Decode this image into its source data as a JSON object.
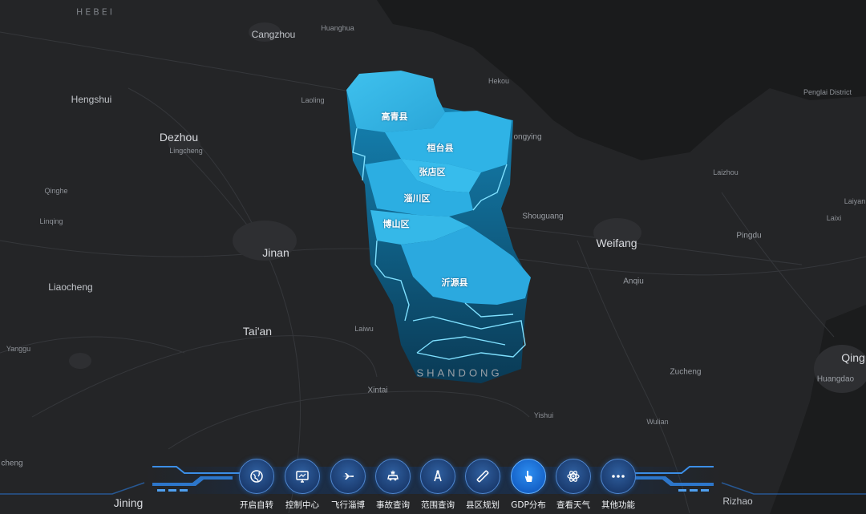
{
  "map": {
    "province_labels": [
      {
        "name": "hebei",
        "text": "HEBEI"
      }
    ],
    "city_labels": [
      {
        "id": "cangzhou",
        "text": "Cangzhou",
        "size": "md"
      },
      {
        "id": "huanghua",
        "text": "Huanghua",
        "size": "xs"
      },
      {
        "id": "hengshui",
        "text": "Hengshui",
        "size": "md"
      },
      {
        "id": "laoling",
        "text": "Laoling",
        "size": "xs"
      },
      {
        "id": "hekou",
        "text": "Hekou",
        "size": "xs"
      },
      {
        "id": "penglai",
        "text": "Penglai District",
        "size": "xs"
      },
      {
        "id": "dezhou",
        "text": "Dezhou",
        "size": "lg"
      },
      {
        "id": "lingcheng",
        "text": "Lingcheng",
        "size": "xs"
      },
      {
        "id": "dongying",
        "text": "ongying",
        "size": "sm"
      },
      {
        "id": "laizhou",
        "text": "Laizhou",
        "size": "xs"
      },
      {
        "id": "qinghe",
        "text": "Qinghe",
        "size": "xs"
      },
      {
        "id": "laiyang",
        "text": "Laiyan",
        "size": "xs"
      },
      {
        "id": "linqing",
        "text": "Linqing",
        "size": "xs"
      },
      {
        "id": "shouguang",
        "text": "Shouguang",
        "size": "sm"
      },
      {
        "id": "laixi",
        "text": "Laixi",
        "size": "xs"
      },
      {
        "id": "pingdu",
        "text": "Pingdu",
        "size": "sm"
      },
      {
        "id": "weifang",
        "text": "Weifang",
        "size": "lg"
      },
      {
        "id": "jinan",
        "text": "Jinan",
        "size": "lg"
      },
      {
        "id": "anqiu",
        "text": "Anqiu",
        "size": "sm"
      },
      {
        "id": "liaocheng",
        "text": "Liaocheng",
        "size": "md"
      },
      {
        "id": "laiwu",
        "text": "Laiwu",
        "size": "xs"
      },
      {
        "id": "taian",
        "text": "Tai'an",
        "size": "lg"
      },
      {
        "id": "qing",
        "text": "Qing",
        "size": "lg"
      },
      {
        "id": "yanggu",
        "text": "Yanggu",
        "size": "xs"
      },
      {
        "id": "zucheng",
        "text": "Zucheng",
        "size": "sm"
      },
      {
        "id": "huangdao",
        "text": "Huangdao",
        "size": "sm"
      },
      {
        "id": "xintai",
        "text": "Xintai",
        "size": "sm"
      },
      {
        "id": "yishui",
        "text": "Yishui",
        "size": "xs"
      },
      {
        "id": "wulian",
        "text": "Wulian",
        "size": "xs"
      },
      {
        "id": "cheng",
        "text": "cheng",
        "size": "sm"
      },
      {
        "id": "jining",
        "text": "Jining",
        "size": "lg"
      },
      {
        "id": "rizhao",
        "text": "Rizhao",
        "size": "md"
      }
    ],
    "shandong_label": "SHANDONG",
    "counties": [
      {
        "id": "gaoqing",
        "text": "高青县"
      },
      {
        "id": "huantai",
        "text": "桓台县"
      },
      {
        "id": "zhangdian",
        "text": "张店区"
      },
      {
        "id": "zichuan",
        "text": "淄川区"
      },
      {
        "id": "boshan",
        "text": "博山区"
      },
      {
        "id": "yiyuan",
        "text": "沂源县"
      }
    ],
    "colors": {
      "background": "#242527",
      "region_top": "#36b7e6",
      "region_side": "#0f6d96",
      "region_outline": "#7fe0ff"
    }
  },
  "toolbar": {
    "items": [
      {
        "id": "auto-rotate",
        "label": "开启自转",
        "icon": "globe-rotate-icon",
        "active": false
      },
      {
        "id": "control-center",
        "label": "控制中心",
        "icon": "monitor-icon",
        "active": false
      },
      {
        "id": "fly-zibo",
        "label": "飞行淄博",
        "icon": "airplane-icon",
        "active": false
      },
      {
        "id": "accident-query",
        "label": "事故查询",
        "icon": "car-crash-icon",
        "active": false
      },
      {
        "id": "range-query",
        "label": "范围查询",
        "icon": "compass-icon",
        "active": false
      },
      {
        "id": "county-planning",
        "label": "县区规划",
        "icon": "ruler-icon",
        "active": false
      },
      {
        "id": "gdp-distribution",
        "label": "GDP分布",
        "icon": "hand-pointer-icon",
        "active": true
      },
      {
        "id": "weather",
        "label": "查看天气",
        "icon": "atom-icon",
        "active": false
      },
      {
        "id": "other-functions",
        "label": "其他功能",
        "icon": "more-icon",
        "active": false
      }
    ],
    "accent_color": "#1b6fd6"
  }
}
